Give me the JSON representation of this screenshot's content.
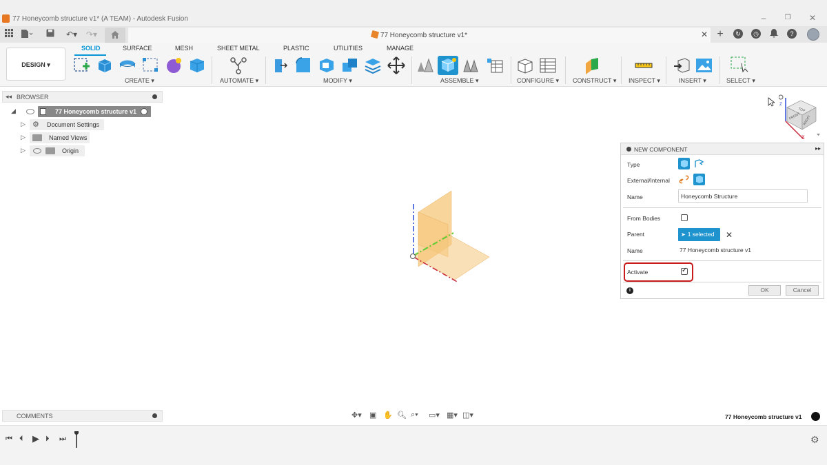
{
  "window": {
    "title": "77 Honeycomb structure v1* (A TEAM) - Autodesk Fusion"
  },
  "tabbar": {
    "doc_tab_title": "77 Honeycomb structure v1*"
  },
  "ribbon": {
    "workspace_label": "DESIGN",
    "tabs": [
      {
        "label": "SOLID",
        "active": true
      },
      {
        "label": "SURFACE"
      },
      {
        "label": "MESH"
      },
      {
        "label": "SHEET METAL"
      },
      {
        "label": "PLASTIC"
      },
      {
        "label": "UTILITIES"
      },
      {
        "label": "MANAGE"
      }
    ],
    "groups": [
      "CREATE",
      "AUTOMATE",
      "MODIFY",
      "ASSEMBLE",
      "CONFIGURE",
      "CONSTRUCT",
      "INSPECT",
      "INSERT",
      "SELECT"
    ]
  },
  "browser": {
    "header": "BROWSER",
    "root": "77 Honeycomb structure v1",
    "items": [
      "Document Settings",
      "Named Views",
      "Origin"
    ]
  },
  "viewcube": {
    "faces": [
      "TOP",
      "FRONT",
      "RIGHT"
    ],
    "axes": [
      "Z",
      "X"
    ]
  },
  "new_component": {
    "title": "NEW COMPONENT",
    "type_label": "Type",
    "external_label": "External/Internal",
    "name_label": "Name",
    "name_value": "Honeycomb Structure",
    "from_bodies_label": "From Bodies",
    "parent_label": "Parent",
    "parent_button": "1 selected",
    "parent_name_label": "Name",
    "parent_name_value": "77 Honeycomb structure v1",
    "activate_label": "Activate",
    "activate_checked": true,
    "from_bodies_checked": false,
    "ok_label": "OK",
    "cancel_label": "Cancel"
  },
  "comments": {
    "label": "COMMENTS"
  },
  "status": {
    "document_name": "77 Honeycomb structure v1"
  },
  "colors": {
    "accent": "#0696d7",
    "highlight": "#c81a1a",
    "plane": "#f6c77a"
  }
}
